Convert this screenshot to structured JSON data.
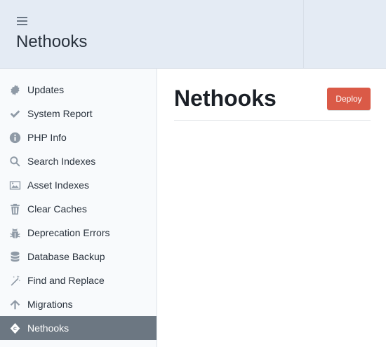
{
  "header": {
    "title": "Nethooks"
  },
  "sidebar": {
    "items": [
      {
        "label": "Updates",
        "icon": "gear-badge-icon"
      },
      {
        "label": "System Report",
        "icon": "checkmark-icon"
      },
      {
        "label": "PHP Info",
        "icon": "info-circle-icon"
      },
      {
        "label": "Search Indexes",
        "icon": "search-icon"
      },
      {
        "label": "Asset Indexes",
        "icon": "image-icon"
      },
      {
        "label": "Clear Caches",
        "icon": "trash-icon"
      },
      {
        "label": "Deprecation Errors",
        "icon": "bug-icon"
      },
      {
        "label": "Database Backup",
        "icon": "database-icon"
      },
      {
        "label": "Find and Replace",
        "icon": "magic-wand-icon"
      },
      {
        "label": "Migrations",
        "icon": "arrow-up-icon"
      },
      {
        "label": "Nethooks",
        "icon": "nethooks-logo-icon",
        "selected": true
      }
    ]
  },
  "main": {
    "title": "Nethooks",
    "deploy_label": "Deploy"
  },
  "colors": {
    "header_bg": "#e4ebf4",
    "sidebar_bg": "#f8fafc",
    "selected_bg": "#6c7782",
    "deploy_bg": "#da5a47"
  }
}
